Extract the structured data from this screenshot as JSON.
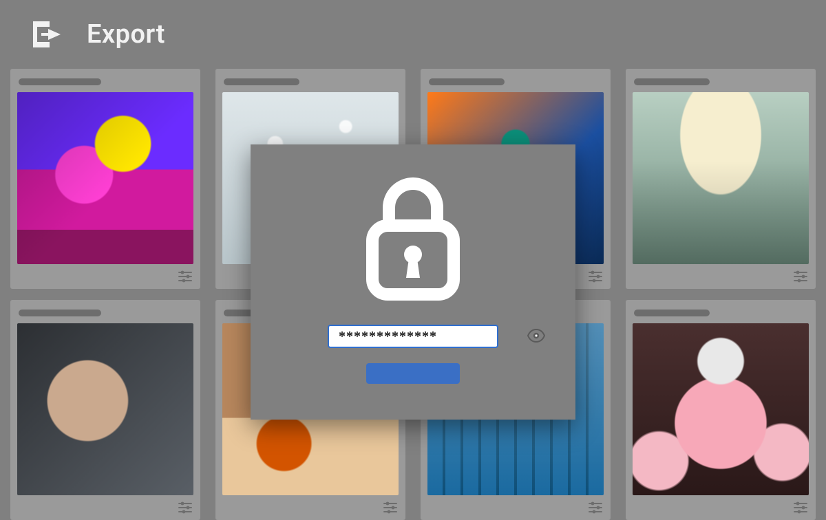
{
  "header": {
    "export_label": "Export",
    "export_icon": "export-icon"
  },
  "gallery": {
    "cards": [
      {
        "icon": "sliders-icon",
        "thumb": "graffiti",
        "title_skeleton_width": 120
      },
      {
        "icon": "sliders-icon",
        "thumb": "splash",
        "title_skeleton_width": 110
      },
      {
        "icon": "sliders-icon",
        "thumb": "peacock",
        "title_skeleton_width": 110
      },
      {
        "icon": "sliders-icon",
        "thumb": "ballet",
        "title_skeleton_width": 110
      },
      {
        "icon": "sliders-icon",
        "thumb": "portrait",
        "title_skeleton_width": 120
      },
      {
        "icon": "sliders-icon",
        "thumb": "basketball",
        "title_skeleton_width": 110
      },
      {
        "icon": "sliders-icon",
        "thumb": "pool",
        "title_skeleton_width": 110
      },
      {
        "icon": "sliders-icon",
        "thumb": "fashion",
        "title_skeleton_width": 110
      }
    ]
  },
  "modal": {
    "lock_icon": "lock-icon",
    "password_mask": "*************",
    "reveal_icon": "eye-icon",
    "submit_label": "",
    "colors": {
      "accent": "#3a6fc5",
      "field_border": "#2f6fd0"
    }
  }
}
